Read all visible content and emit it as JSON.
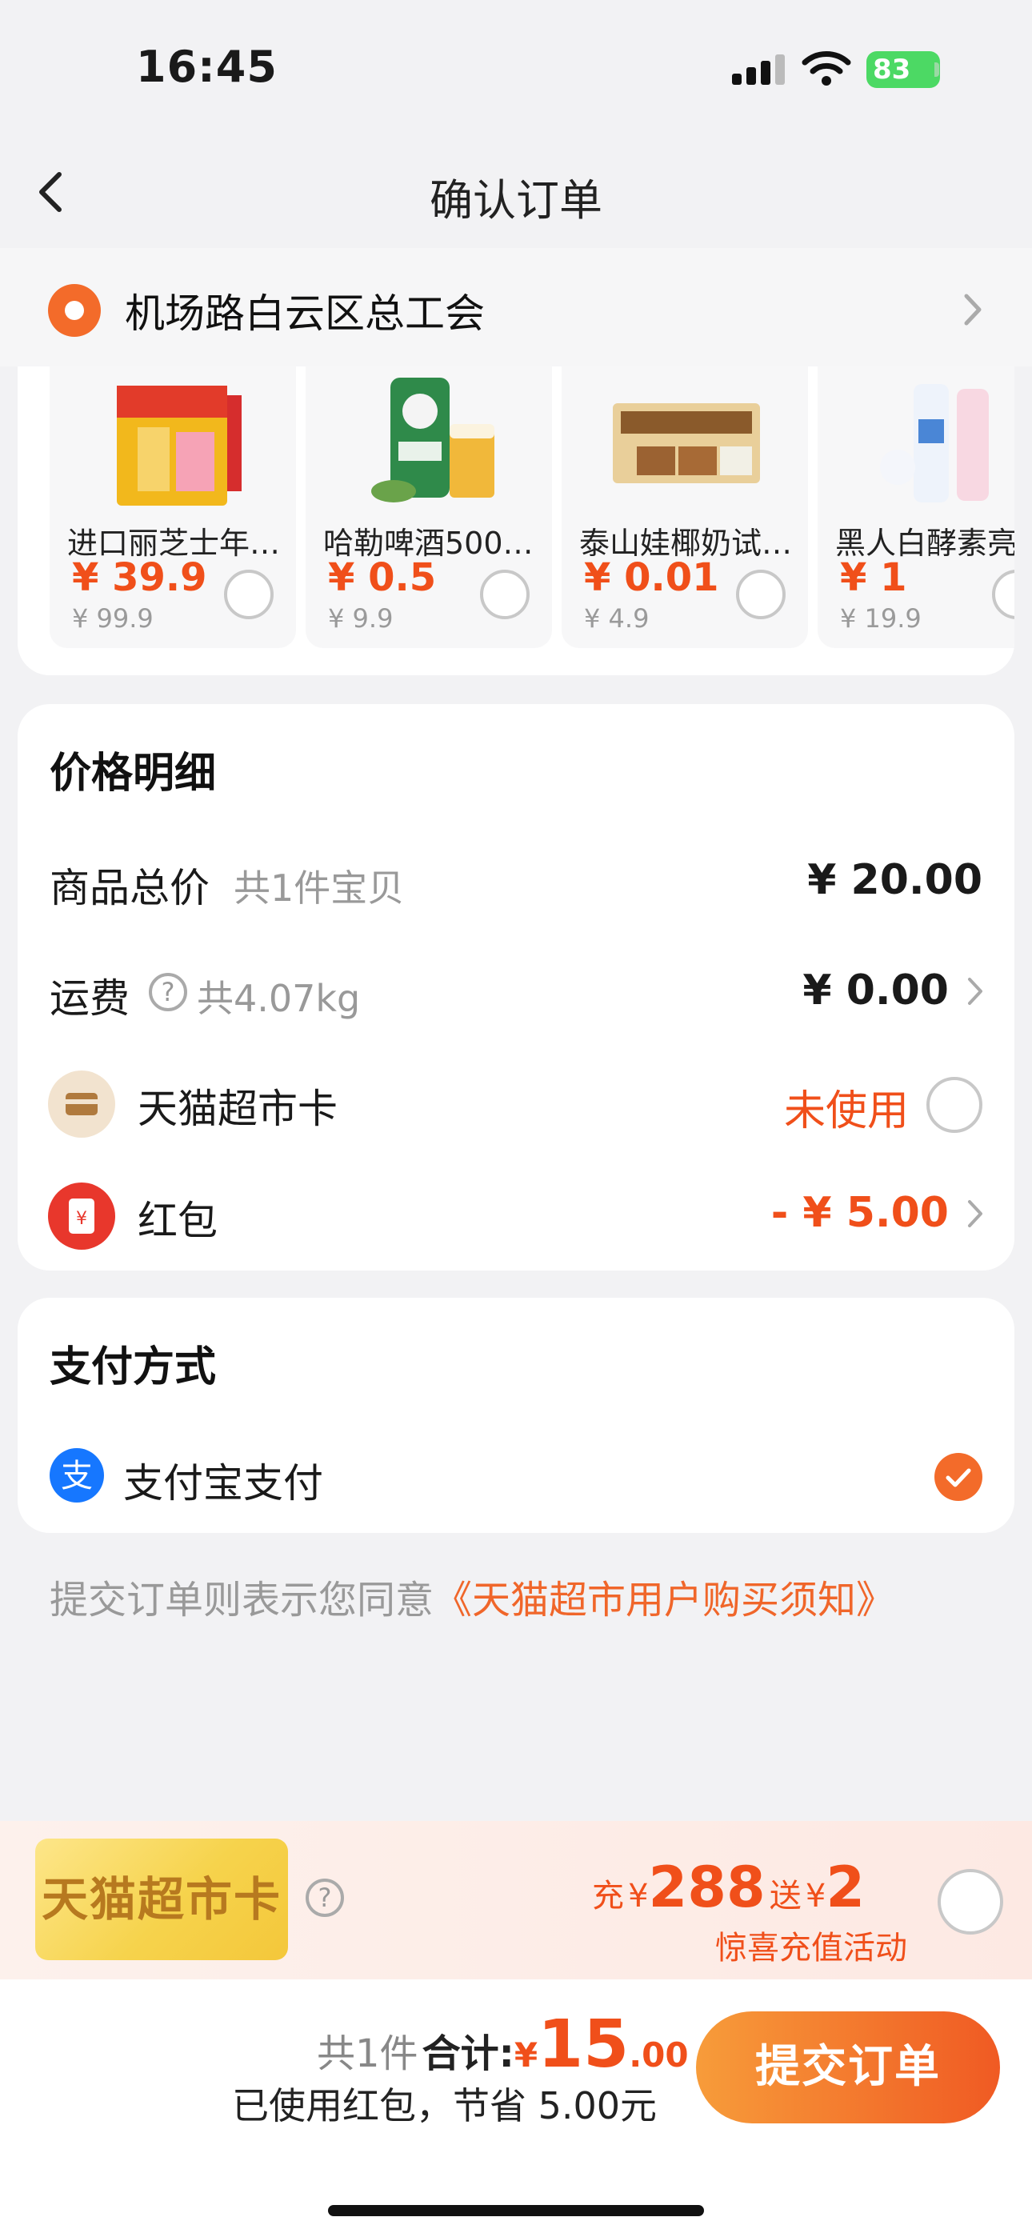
{
  "status_bar": {
    "time": "16:45",
    "battery": "83"
  },
  "nav": {
    "title": "确认订单"
  },
  "address": {
    "text": "机场路白云区总工会"
  },
  "products": [
    {
      "name": "进口丽芝士年…",
      "price": "¥ 39.9",
      "original": "¥ 99.9"
    },
    {
      "name": "哈勒啤酒500…",
      "price": "¥ 0.5",
      "original": "¥ 9.9"
    },
    {
      "name": "泰山娃椰奶试…",
      "price": "¥ 0.01",
      "original": "¥ 4.9"
    },
    {
      "name": "黑人白酵素亮",
      "price": "¥ 1",
      "original": "¥ 19.9"
    }
  ],
  "price_detail": {
    "title": "价格明细",
    "goods_total": {
      "label": "商品总价",
      "sub": "共1件宝贝",
      "value": "¥ 20.00"
    },
    "shipping": {
      "label": "运费",
      "sub": "共4.07kg",
      "value": "¥ 0.00"
    },
    "tmall_card": {
      "label": "天猫超市卡",
      "value": "未使用"
    },
    "red_packet": {
      "label": "红包",
      "value": "- ¥ 5.00"
    }
  },
  "payment": {
    "title": "支付方式",
    "method": "支付宝支付"
  },
  "agreement": {
    "prefix": "提交订单则表示您同意",
    "link": "《天猫超市用户购买须知》"
  },
  "promo": {
    "card_label": "天猫超市卡",
    "charge_word": "充",
    "charge_yen": "¥",
    "charge_amount": "288",
    "gift_word": "送",
    "gift_yen": "¥",
    "gift_amount": "2",
    "subtitle": "惊喜充值活动"
  },
  "bottom": {
    "count": "共1件",
    "total_label": "合计:",
    "currency": "¥",
    "total_int": "15",
    "total_dec": ".00",
    "saved_text": "已使用红包，节省 5.00元",
    "submit_label": "提交订单"
  },
  "colors": {
    "accent": "#f04f1a",
    "button_start": "#f79c3a",
    "button_end": "#f05a23",
    "background": "#f2f2f4"
  }
}
